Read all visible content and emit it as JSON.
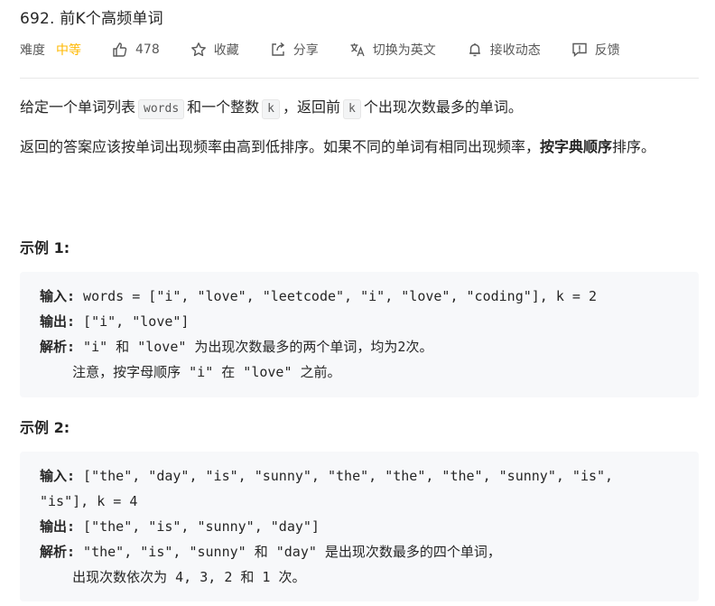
{
  "problem": {
    "title": "692. 前K个高频单词",
    "difficulty_label": "难度",
    "difficulty_value": "中等",
    "likes": "478",
    "favorite_label": "收藏",
    "share_label": "分享",
    "switch_lang_label": "切换为英文",
    "notify_label": "接收动态",
    "feedback_label": "反馈"
  },
  "description": {
    "p1_a": "给定一个单词列表",
    "p1_code1": "words",
    "p1_b": "和一个整数",
    "p1_code2": "k",
    "p1_c": "，返回前",
    "p1_code3": "k",
    "p1_d": "个出现次数最多的单词。",
    "p2_a": "返回的答案应该按单词出现频率由高到低排序。如果不同的单词有相同出现频率，",
    "p2_bold": "按字典顺序",
    "p2_b": "排序。"
  },
  "examples": [
    {
      "title": "示例 1:",
      "input_label": "输入:",
      "input": " words = [\"i\", \"love\", \"leetcode\", \"i\", \"love\", \"coding\"], k = 2",
      "output_label": "输出:",
      "output": " [\"i\", \"love\"]",
      "explain_label": "解析:",
      "explain_1": " \"i\" 和 \"love\" 为出现次数最多的两个单词，均为2次。",
      "explain_2": "    注意，按字母顺序 \"i\" 在 \"love\" 之前。"
    },
    {
      "title": "示例 2:",
      "input_label": "输入:",
      "input": " [\"the\", \"day\", \"is\", \"sunny\", \"the\", \"the\", \"the\", \"sunny\", \"is\",",
      "input_cont": "\"is\"], k = 4",
      "output_label": "输出:",
      "output": " [\"the\", \"is\", \"sunny\", \"day\"]",
      "explain_label": "解析:",
      "explain_1": " \"the\", \"is\", \"sunny\" 和 \"day\" 是出现次数最多的四个单词，",
      "explain_2": "    出现次数依次为 4, 3, 2 和 1 次。"
    }
  ],
  "colors": {
    "difficulty_medium": "#ffb800",
    "code_bg": "#f7f8fa",
    "text": "#262626",
    "muted": "#595959"
  },
  "icons": {
    "likes": "thumbs-up-icon",
    "favorite": "star-icon",
    "share": "share-icon",
    "switch_lang": "translate-icon",
    "notify": "bell-icon",
    "feedback": "feedback-icon"
  }
}
